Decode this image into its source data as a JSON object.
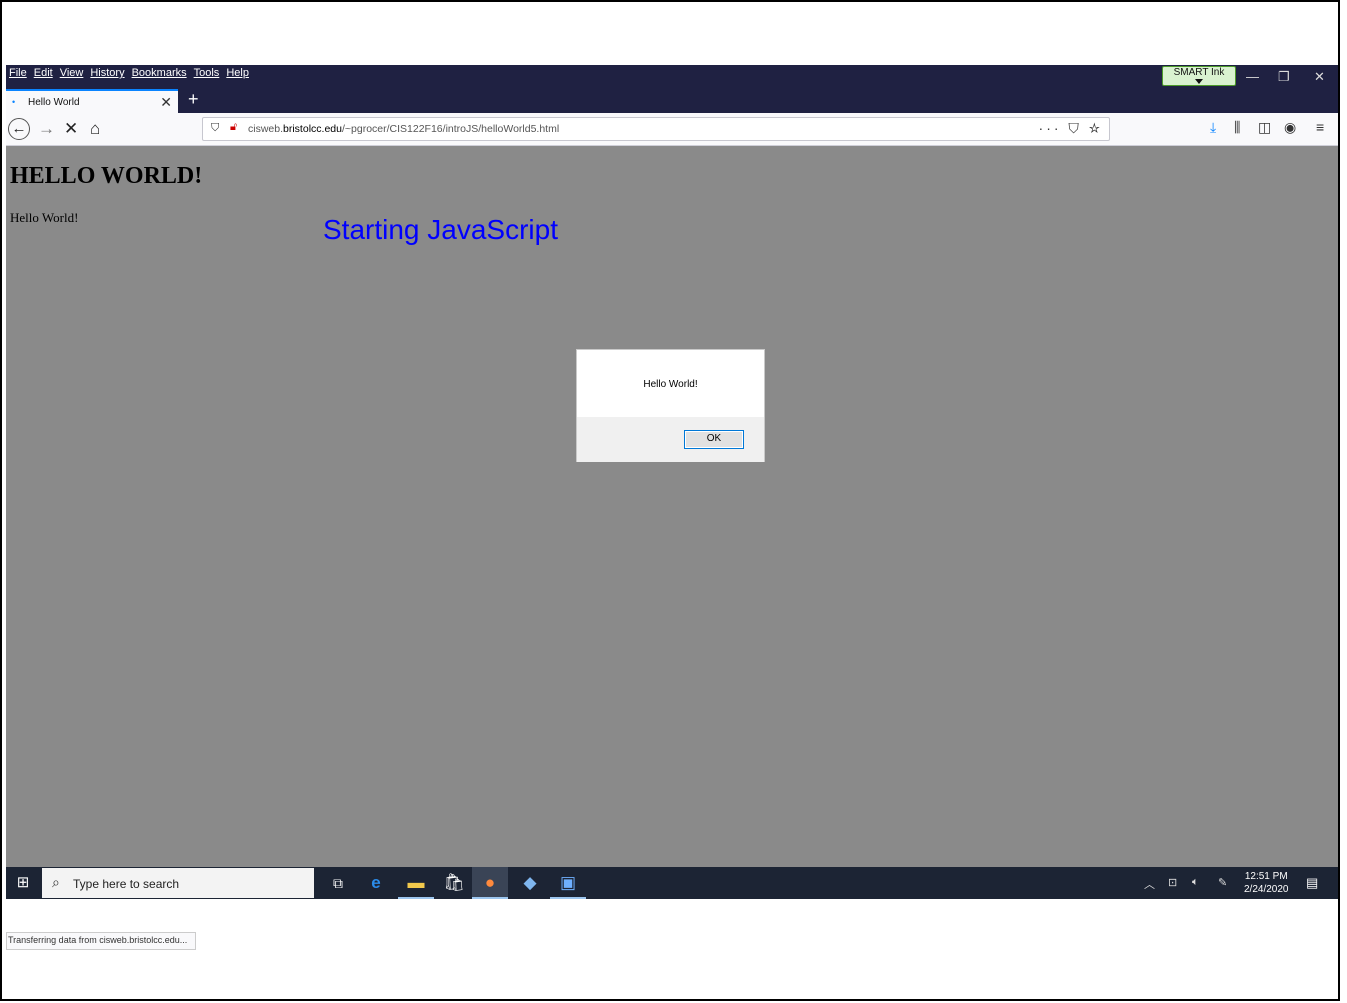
{
  "menu": [
    "File",
    "Edit",
    "View",
    "History",
    "Bookmarks",
    "Tools",
    "Help"
  ],
  "smart_ink": "SMART Ink",
  "window_controls": {
    "minimize": "—",
    "restore": "❐",
    "close": "✕"
  },
  "tab": {
    "title": "Hello World",
    "close": "✕"
  },
  "new_tab": "+",
  "nav": {
    "back": "←",
    "forward": "→",
    "stop": "✕",
    "home": "⌂"
  },
  "url": {
    "prefix": "cisweb.",
    "domain": "bristolcc.edu",
    "path": "/~pgrocer/CIS122F16/introJS/helloWorld5.html",
    "page_actions": "··· ⛉ ☆"
  },
  "toolbar_icons": [
    "download-icon",
    "library-icon",
    "sidebar-icon",
    "account-icon",
    "menu-icon"
  ],
  "page": {
    "heading": "HELLO WORLD!",
    "paragraph": "Hello World!",
    "blue_text": "Starting JavaScript"
  },
  "dialog": {
    "message": "Hello World!",
    "ok": "OK"
  },
  "status": "Transferring data from cisweb.bristolcc.edu...",
  "taskbar": {
    "search_placeholder": "Type here to search",
    "time": "12:51 PM",
    "date": "2/24/2020"
  },
  "colors": {
    "page_bg": "#8a8a8a",
    "menubar": "#1f2142",
    "blue_text": "#0000ff",
    "taskbar": "#1c2434"
  }
}
